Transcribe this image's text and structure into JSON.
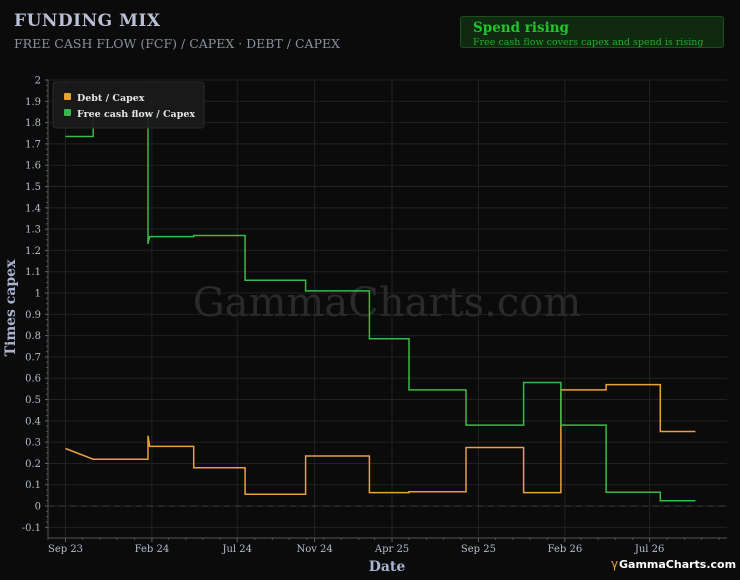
{
  "header": {
    "title": "FUNDING MIX",
    "subtitle": "FREE CASH FLOW (FCF) / CAPEX · DEBT / CAPEX"
  },
  "badge": {
    "title": "Spend rising",
    "description": "Free cash flow covers capex and spend is rising"
  },
  "watermark": "GammaCharts.com",
  "brand": "GammaCharts.com",
  "colors": {
    "background": "#0b0b0b",
    "debt": "#e9a23b",
    "fcf": "#3cb84a",
    "badge_green": "#22c42a"
  },
  "chart_data": {
    "type": "line",
    "xlabel": "Date",
    "ylabel": "Times capex",
    "ylim": [
      -0.15,
      2
    ],
    "y_ticks": [
      "-0.1",
      "0",
      "0.1",
      "0.2",
      "0.3",
      "0.4",
      "0.5",
      "0.6",
      "0.7",
      "0.8",
      "0.9",
      "1",
      "1.1",
      "1.2",
      "1.3",
      "1.4",
      "1.5",
      "1.6",
      "1.7",
      "1.8",
      "1.9",
      "2"
    ],
    "x_range": [
      "2023-08-01",
      "2026-11-15"
    ],
    "x_ticks": [
      {
        "date": "2023-09-01",
        "label": "Sep 23"
      },
      {
        "date": "2024-02-01",
        "label": "Feb 24"
      },
      {
        "date": "2024-07-01",
        "label": "Jul 24"
      },
      {
        "date": "2024-11-15",
        "label": "Nov 24"
      },
      {
        "date": "2025-04-01",
        "label": "Apr 25"
      },
      {
        "date": "2025-09-01",
        "label": "Sep 25"
      },
      {
        "date": "2026-02-01",
        "label": "Feb 26"
      },
      {
        "date": "2026-07-01",
        "label": "Jul 26"
      }
    ],
    "grid": true,
    "legend_position": "top-left",
    "reference_line": 0,
    "series": [
      {
        "name": "Debt / Capex",
        "color": "#e9a23b",
        "step": true,
        "points": [
          [
            "2023-09-01",
            0.27
          ],
          [
            "2023-10-20",
            0.22
          ],
          [
            "2024-01-25",
            0.22
          ],
          [
            "2024-01-25",
            0.33
          ],
          [
            "2024-01-28",
            0.28
          ],
          [
            "2024-04-15",
            0.28
          ],
          [
            "2024-04-15",
            0.18
          ],
          [
            "2024-07-15",
            0.18
          ],
          [
            "2024-07-15",
            0.055
          ],
          [
            "2024-10-30",
            0.055
          ],
          [
            "2024-10-30",
            0.235
          ],
          [
            "2025-02-20",
            0.235
          ],
          [
            "2025-02-20",
            0.063
          ],
          [
            "2025-05-01",
            0.063
          ],
          [
            "2025-05-01",
            0.067
          ],
          [
            "2025-08-10",
            0.067
          ],
          [
            "2025-08-10",
            0.275
          ],
          [
            "2025-11-20",
            0.275
          ],
          [
            "2025-11-20",
            0.063
          ],
          [
            "2026-01-25",
            0.063
          ],
          [
            "2026-01-25",
            0.545
          ],
          [
            "2026-04-15",
            0.545
          ],
          [
            "2026-04-15",
            0.57
          ],
          [
            "2026-07-20",
            0.57
          ],
          [
            "2026-07-20",
            0.35
          ],
          [
            "2026-09-20",
            0.35
          ]
        ]
      },
      {
        "name": "Free cash flow / Capex",
        "color": "#3cb84a",
        "step": true,
        "points": [
          [
            "2023-09-01",
            1.735
          ],
          [
            "2023-10-20",
            1.735
          ],
          [
            "2023-10-20",
            1.83
          ],
          [
            "2024-01-25",
            1.83
          ],
          [
            "2024-01-25",
            1.23
          ],
          [
            "2024-01-28",
            1.265
          ],
          [
            "2024-04-15",
            1.265
          ],
          [
            "2024-04-15",
            1.27
          ],
          [
            "2024-07-15",
            1.27
          ],
          [
            "2024-07-15",
            1.06
          ],
          [
            "2024-10-30",
            1.06
          ],
          [
            "2024-10-30",
            1.01
          ],
          [
            "2025-02-20",
            1.01
          ],
          [
            "2025-02-20",
            0.785
          ],
          [
            "2025-05-01",
            0.785
          ],
          [
            "2025-05-01",
            0.545
          ],
          [
            "2025-08-10",
            0.545
          ],
          [
            "2025-08-10",
            0.38
          ],
          [
            "2025-11-20",
            0.38
          ],
          [
            "2025-11-20",
            0.58
          ],
          [
            "2026-01-25",
            0.58
          ],
          [
            "2026-01-25",
            0.38
          ],
          [
            "2026-04-15",
            0.38
          ],
          [
            "2026-04-15",
            0.065
          ],
          [
            "2026-07-20",
            0.065
          ],
          [
            "2026-07-20",
            0.025
          ],
          [
            "2026-09-20",
            0.025
          ]
        ]
      }
    ]
  }
}
